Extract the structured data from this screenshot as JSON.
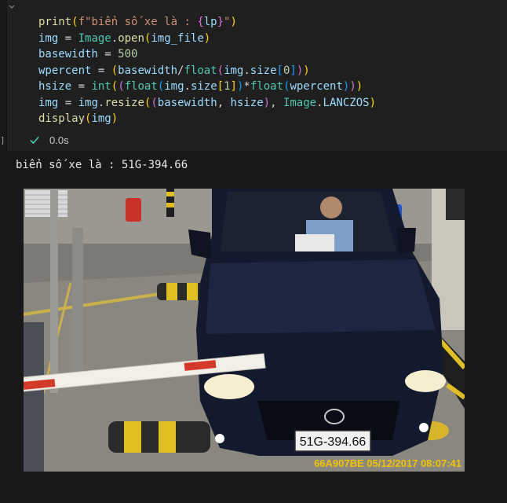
{
  "cell": {
    "code_lines": [
      [
        {
          "t": "print",
          "c": "kw"
        },
        {
          "t": "(",
          "c": "brk1"
        },
        {
          "t": "f\"biển số xe là : ",
          "c": "str"
        },
        {
          "t": "{",
          "c": "brk2"
        },
        {
          "t": "lp",
          "c": "var"
        },
        {
          "t": "}",
          "c": "brk2"
        },
        {
          "t": "\"",
          "c": "str"
        },
        {
          "t": ")",
          "c": "brk1"
        }
      ],
      [
        {
          "t": "img",
          "c": "var"
        },
        {
          "t": " = ",
          "c": ""
        },
        {
          "t": "Image",
          "c": "cls"
        },
        {
          "t": ".",
          "c": ""
        },
        {
          "t": "open",
          "c": "kw"
        },
        {
          "t": "(",
          "c": "brk1"
        },
        {
          "t": "img_file",
          "c": "var"
        },
        {
          "t": ")",
          "c": "brk1"
        }
      ],
      [
        {
          "t": "basewidth",
          "c": "var"
        },
        {
          "t": " = ",
          "c": ""
        },
        {
          "t": "500",
          "c": "num"
        }
      ],
      [
        {
          "t": "wpercent",
          "c": "var"
        },
        {
          "t": " = ",
          "c": ""
        },
        {
          "t": "(",
          "c": "brk1"
        },
        {
          "t": "basewidth",
          "c": "var"
        },
        {
          "t": "/",
          "c": ""
        },
        {
          "t": "float",
          "c": "cls"
        },
        {
          "t": "(",
          "c": "brk2"
        },
        {
          "t": "img",
          "c": "var"
        },
        {
          "t": ".",
          "c": ""
        },
        {
          "t": "size",
          "c": "var"
        },
        {
          "t": "[",
          "c": "brk3"
        },
        {
          "t": "0",
          "c": "num"
        },
        {
          "t": "]",
          "c": "brk3"
        },
        {
          "t": ")",
          "c": "brk2"
        },
        {
          "t": ")",
          "c": "brk1"
        }
      ],
      [
        {
          "t": "hsize",
          "c": "var"
        },
        {
          "t": " = ",
          "c": ""
        },
        {
          "t": "int",
          "c": "cls"
        },
        {
          "t": "(",
          "c": "brk1"
        },
        {
          "t": "(",
          "c": "brk2"
        },
        {
          "t": "float",
          "c": "cls"
        },
        {
          "t": "(",
          "c": "brk3"
        },
        {
          "t": "img",
          "c": "var"
        },
        {
          "t": ".",
          "c": ""
        },
        {
          "t": "size",
          "c": "var"
        },
        {
          "t": "[",
          "c": "brk1"
        },
        {
          "t": "1",
          "c": "num"
        },
        {
          "t": "]",
          "c": "brk1"
        },
        {
          "t": ")",
          "c": "brk3"
        },
        {
          "t": "*",
          "c": ""
        },
        {
          "t": "float",
          "c": "cls"
        },
        {
          "t": "(",
          "c": "brk3"
        },
        {
          "t": "wpercent",
          "c": "var"
        },
        {
          "t": ")",
          "c": "brk3"
        },
        {
          "t": ")",
          "c": "brk2"
        },
        {
          "t": ")",
          "c": "brk1"
        }
      ],
      [
        {
          "t": "img",
          "c": "var"
        },
        {
          "t": " = ",
          "c": ""
        },
        {
          "t": "img",
          "c": "var"
        },
        {
          "t": ".",
          "c": ""
        },
        {
          "t": "resize",
          "c": "kw"
        },
        {
          "t": "(",
          "c": "brk1"
        },
        {
          "t": "(",
          "c": "brk2"
        },
        {
          "t": "basewidth",
          "c": "var"
        },
        {
          "t": ", ",
          "c": ""
        },
        {
          "t": "hsize",
          "c": "var"
        },
        {
          "t": ")",
          "c": "brk2"
        },
        {
          "t": ", ",
          "c": ""
        },
        {
          "t": "Image",
          "c": "cls"
        },
        {
          "t": ".",
          "c": ""
        },
        {
          "t": "LANCZOS",
          "c": "var"
        },
        {
          "t": ")",
          "c": "brk1"
        }
      ],
      [
        {
          "t": "display",
          "c": "kw"
        },
        {
          "t": "(",
          "c": "brk1"
        },
        {
          "t": "img",
          "c": "var"
        },
        {
          "t": ")",
          "c": "brk1"
        }
      ]
    ],
    "status": {
      "icon": "check-icon",
      "duration": "0.0s",
      "success_color": "#4ec9b0"
    },
    "gutter_mark": "]"
  },
  "output": {
    "text": "biển số xe là : 51G-394.66",
    "image": {
      "plate_text": "51G-394.66",
      "timestamp_overlay": "66A907BE  05/12/2017 08:07:41",
      "timestamp_color": "#f2c300"
    }
  }
}
